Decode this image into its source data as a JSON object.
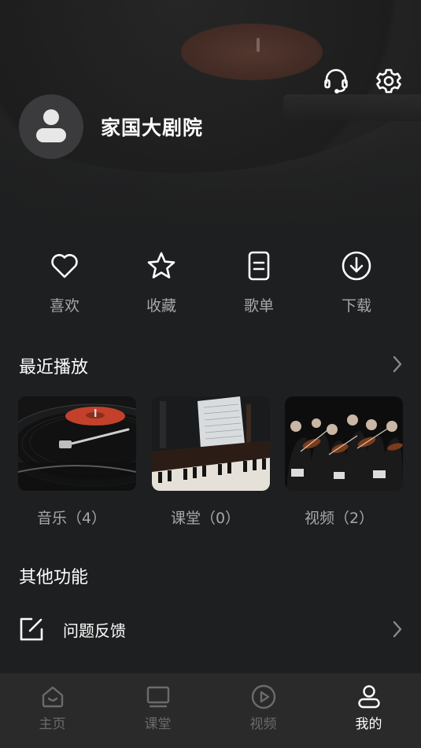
{
  "profile": {
    "name": "家国大剧院"
  },
  "header": {
    "support_icon": "headset-icon",
    "settings_icon": "gear-icon"
  },
  "quick_actions": [
    {
      "label": "喜欢",
      "icon": "heart-icon"
    },
    {
      "label": "收藏",
      "icon": "star-icon"
    },
    {
      "label": "歌单",
      "icon": "playlist-doc-icon"
    },
    {
      "label": "下载",
      "icon": "download-circle-icon"
    }
  ],
  "recent": {
    "title": "最近播放",
    "items": [
      {
        "label": "音乐（4）",
        "thumb": "turntable-record-thumbnail"
      },
      {
        "label": "课堂（0）",
        "thumb": "piano-sheet-music-thumbnail"
      },
      {
        "label": "视频（2）",
        "thumb": "orchestra-violins-thumbnail"
      }
    ]
  },
  "other": {
    "title": "其他功能",
    "feedback_label": "问题反馈"
  },
  "tabbar": {
    "tabs": [
      {
        "label": "主页",
        "icon": "home-icon",
        "active": false
      },
      {
        "label": "课堂",
        "icon": "screen-icon",
        "active": false
      },
      {
        "label": "视频",
        "icon": "play-circle-icon",
        "active": false
      },
      {
        "label": "我的",
        "icon": "person-icon",
        "active": true
      }
    ]
  },
  "colors": {
    "background": "#1e1f20",
    "tabbar": "#2a2a2b",
    "muted_text": "#a7a7a7",
    "tab_inactive": "#6b6b6d",
    "record_label": "#c3412b"
  }
}
